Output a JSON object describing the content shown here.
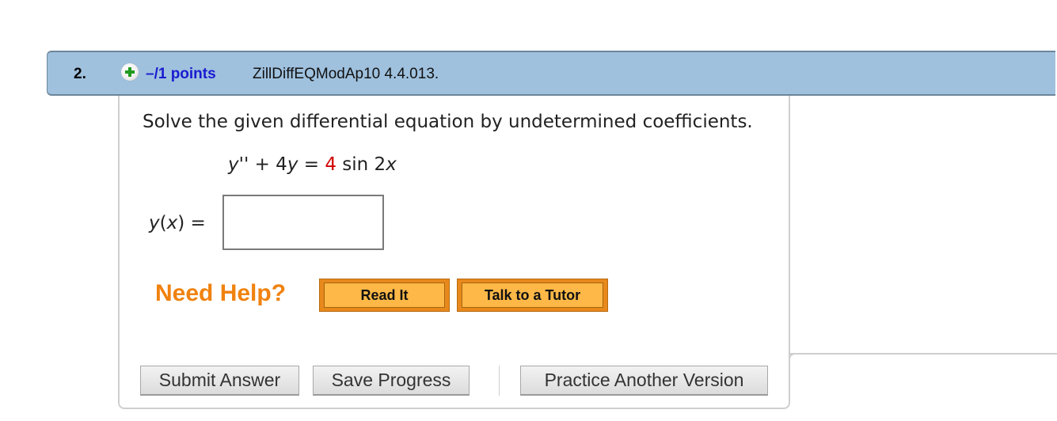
{
  "question": {
    "number": "2.",
    "expand_icon": "plus-circle-icon",
    "points": "–/1 points",
    "reference": "ZillDiffEQModAp10 4.4.013.",
    "prompt": "Solve the given differential equation by undetermined coefficients.",
    "equation": {
      "lhs_y": "y",
      "lhs_prime": "''",
      "lhs_rest": " + 4",
      "lhs_y2": "y",
      "equals": " = ",
      "coefficient": "4",
      "rhs_func": " sin 2",
      "rhs_var": "x",
      "coefficient_color": "#d10000"
    },
    "answer": {
      "label_y": "y",
      "label_open": "(",
      "label_x": "x",
      "label_close": ") =",
      "value": "",
      "placeholder": ""
    }
  },
  "help": {
    "label": "Need Help?",
    "read_it": "Read It",
    "talk_to_tutor": "Talk to a Tutor"
  },
  "actions": {
    "submit": "Submit Answer",
    "save": "Save Progress",
    "practice": "Practice Another Version"
  },
  "colors": {
    "header_bg": "#9fc1de",
    "points_text": "#1b1bd0",
    "need_help": "#f0820f",
    "help_button": "#fdb847"
  }
}
